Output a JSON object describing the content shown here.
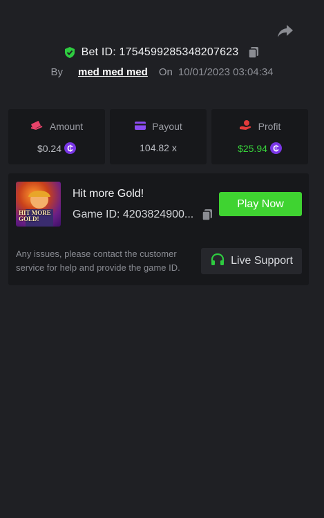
{
  "header": {
    "bet_id_label": "Bet ID: 1754599285348207623",
    "by_label": "By",
    "username": "med med med",
    "on_label": "On",
    "date": "10/01/2023 03:04:34"
  },
  "stats": {
    "amount": {
      "label": "Amount",
      "value": "$0.24"
    },
    "payout": {
      "label": "Payout",
      "value": "104.82 x"
    },
    "profit": {
      "label": "Profit",
      "value": "$25.94"
    }
  },
  "coin_symbol": "₵",
  "game": {
    "thumbnail_title": "HIT MORE GOLD!",
    "name": "Hit more Gold!",
    "id_label": "Game ID: 4203824900...",
    "play_label": "Play Now"
  },
  "support": {
    "notice": "Any issues, please contact the customer service for help and provide the game ID.",
    "button_label": "Live Support"
  },
  "colors": {
    "background": "#1f2024",
    "card": "#17181b",
    "accent_green": "#3fd331",
    "profit_green": "#37d33a",
    "coin_purple": "#7a36e6"
  },
  "icons": [
    "share-icon",
    "shield-check-icon",
    "copy-icon",
    "amount-icon",
    "payout-card-icon",
    "profit-hand-icon",
    "coin-icon",
    "headset-icon"
  ]
}
